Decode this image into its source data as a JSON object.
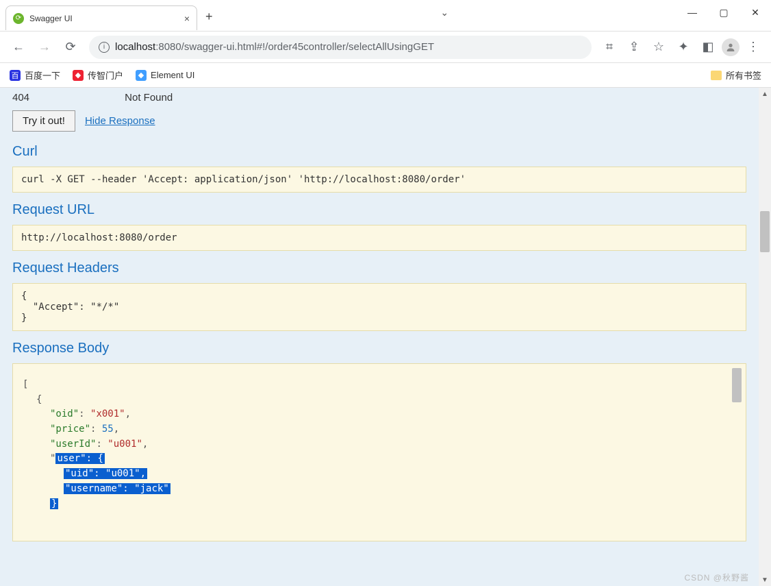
{
  "window": {
    "tab_title": "Swagger UI",
    "min_tip": "最小化",
    "max_tip": "最大化",
    "close_tip": "关闭"
  },
  "url": {
    "host_weak": "localhost",
    "host_port": ":8080",
    "path": "/swagger-ui.html#!/order45controller/selectAllUsingGET"
  },
  "bookmarks": {
    "baidu": "百度一下",
    "chuanzhi": "传智门户",
    "element": "Element UI",
    "all": "所有书签"
  },
  "swagger": {
    "status_404": "404",
    "status_404_text": "Not Found",
    "try_it": "Try it out!",
    "hide_response": "Hide Response",
    "curl_label": "Curl",
    "curl_cmd": "curl -X GET --header 'Accept: application/json' 'http://localhost:8080/order'",
    "request_url_label": "Request URL",
    "request_url": "http://localhost:8080/order",
    "request_headers_label": "Request Headers",
    "request_headers": "{\n  \"Accept\": \"*/*\"\n}",
    "response_body_label": "Response Body",
    "json": {
      "oid_k": "\"oid\"",
      "oid_v": "\"x001\"",
      "price_k": "\"price\"",
      "price_v": "55",
      "userId_k": "\"userId\"",
      "userId_v": "\"u001\"",
      "user_k": "\"user\"",
      "uid_k": "\"uid\"",
      "uid_v": "\"u001\"",
      "username_k": "\"username\"",
      "username_v": "\"jack\""
    }
  },
  "watermark": "CSDN @秋野酱"
}
